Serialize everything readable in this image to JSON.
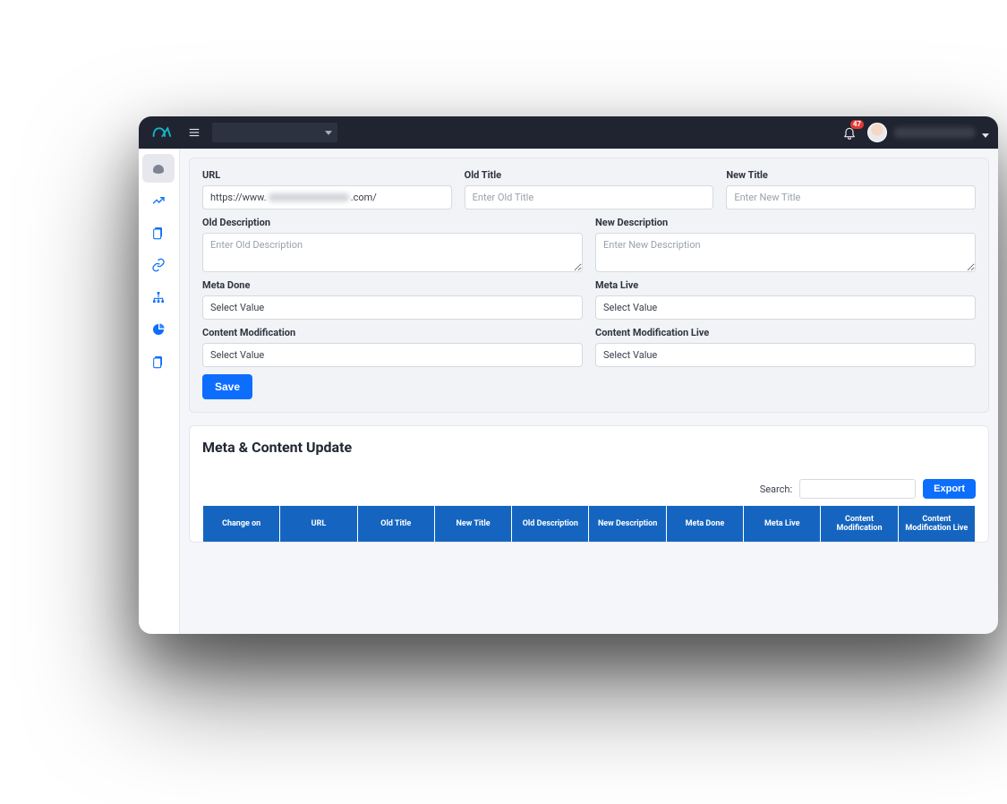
{
  "topbar": {
    "notification_count": "47"
  },
  "sidebar": {
    "items": [
      {
        "name": "dashboard"
      },
      {
        "name": "analytics"
      },
      {
        "name": "pages"
      },
      {
        "name": "links"
      },
      {
        "name": "sitemap"
      },
      {
        "name": "reports"
      },
      {
        "name": "copy"
      }
    ]
  },
  "form": {
    "url": {
      "label": "URL",
      "value": "https://www.",
      "suffix": ".com/"
    },
    "old_title": {
      "label": "Old Title",
      "placeholder": "Enter Old Title"
    },
    "new_title": {
      "label": "New Title",
      "placeholder": "Enter New Title"
    },
    "old_desc": {
      "label": "Old Description",
      "placeholder": "Enter Old Description"
    },
    "new_desc": {
      "label": "New Description",
      "placeholder": "Enter New Description"
    },
    "meta_done": {
      "label": "Meta Done",
      "value": "Select Value"
    },
    "meta_live": {
      "label": "Meta Live",
      "value": "Select Value"
    },
    "content_mod": {
      "label": "Content Modification",
      "value": "Select Value"
    },
    "content_mod_live": {
      "label": "Content Modification Live",
      "value": "Select Value"
    },
    "save_label": "Save"
  },
  "panel": {
    "title": "Meta & Content Update",
    "search_label": "Search:",
    "export_label": "Export",
    "columns": [
      "Change on",
      "URL",
      "Old Title",
      "New Title",
      "Old Description",
      "New Description",
      "Meta Done",
      "Meta Live",
      "Content Modification",
      "Content Modification Live"
    ]
  }
}
